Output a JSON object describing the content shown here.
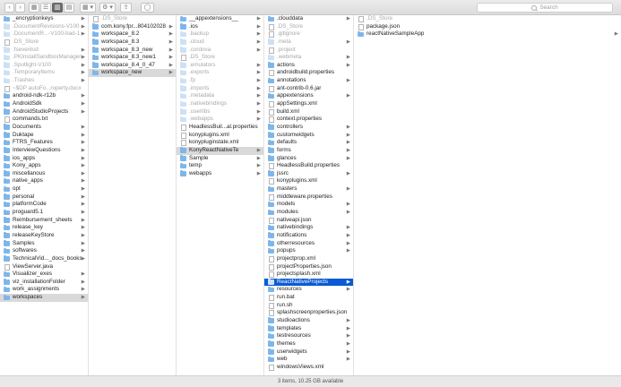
{
  "toolbar": {
    "back": "‹",
    "forward": "›",
    "view_icons": "▦",
    "view_list": "☰",
    "view_columns": "▥",
    "view_gallery": "▤",
    "group": "▦ ▾",
    "action": "⚙ ▾",
    "share": "⇪",
    "tag": "◯",
    "search_placeholder": "Search"
  },
  "columns": [
    [
      {
        "name": "_encryptionkeys",
        "kind": "folder",
        "dim": false,
        "arrow": true
      },
      {
        "name": ".DocumentRevisions-V100",
        "kind": "folder",
        "dim": true,
        "arrow": true
      },
      {
        "name": ".DocumentR...-V100-bad-1",
        "kind": "folder",
        "dim": true,
        "arrow": true
      },
      {
        "name": ".DS_Store",
        "kind": "file",
        "dim": true,
        "arrow": false
      },
      {
        "name": ".fseventsd",
        "kind": "folder",
        "dim": true,
        "arrow": true
      },
      {
        "name": ".PKInstallSandboxManager",
        "kind": "folder",
        "dim": true,
        "arrow": true
      },
      {
        "name": ".Spotlight-V100",
        "kind": "folder",
        "dim": true,
        "arrow": true
      },
      {
        "name": ".TemporaryItems",
        "kind": "folder",
        "dim": true,
        "arrow": true
      },
      {
        "name": ".Trashes",
        "kind": "folder",
        "dim": true,
        "arrow": true
      },
      {
        "name": "~$DP autoFo...roperty.docx",
        "kind": "file",
        "dim": true,
        "arrow": false
      },
      {
        "name": "android-ndk-r12b",
        "kind": "folder",
        "dim": false,
        "arrow": true
      },
      {
        "name": "AndroidSdk",
        "kind": "folder",
        "dim": false,
        "arrow": true
      },
      {
        "name": "AndroidStudioProjects",
        "kind": "folder",
        "dim": false,
        "arrow": true
      },
      {
        "name": "commands.txt",
        "kind": "file",
        "dim": false,
        "arrow": false
      },
      {
        "name": "Documents",
        "kind": "folder",
        "dim": false,
        "arrow": true
      },
      {
        "name": "Duktape",
        "kind": "folder",
        "dim": false,
        "arrow": true
      },
      {
        "name": "FTRS_Features",
        "kind": "folder",
        "dim": false,
        "arrow": true
      },
      {
        "name": "InterviewQuestions",
        "kind": "folder",
        "dim": false,
        "arrow": true
      },
      {
        "name": "ios_apps",
        "kind": "folder",
        "dim": false,
        "arrow": true
      },
      {
        "name": "Kony_apps",
        "kind": "folder",
        "dim": false,
        "arrow": true
      },
      {
        "name": "miscellanous",
        "kind": "folder",
        "dim": false,
        "arrow": true
      },
      {
        "name": "native_apps",
        "kind": "folder",
        "dim": false,
        "arrow": true
      },
      {
        "name": "opt",
        "kind": "folder",
        "dim": false,
        "arrow": true
      },
      {
        "name": "personal",
        "kind": "folder",
        "dim": false,
        "arrow": true
      },
      {
        "name": "platformCode",
        "kind": "folder",
        "dim": false,
        "arrow": true
      },
      {
        "name": "proguard5.1",
        "kind": "folder",
        "dim": false,
        "arrow": true
      },
      {
        "name": "Reimbursement_sheets",
        "kind": "folder",
        "dim": false,
        "arrow": true
      },
      {
        "name": "release_key",
        "kind": "folder",
        "dim": false,
        "arrow": true
      },
      {
        "name": "releaseKeyStore",
        "kind": "folder",
        "dim": false,
        "arrow": true
      },
      {
        "name": "Samples",
        "kind": "folder",
        "dim": false,
        "arrow": true
      },
      {
        "name": "softwares",
        "kind": "folder",
        "dim": false,
        "arrow": true
      },
      {
        "name": "TechnicalVid..._docs_books",
        "kind": "folder",
        "dim": false,
        "arrow": true
      },
      {
        "name": "ViewServer.java",
        "kind": "file",
        "dim": false,
        "arrow": false
      },
      {
        "name": "Visualizer_exes",
        "kind": "folder",
        "dim": false,
        "arrow": true
      },
      {
        "name": "viz_installationFolder",
        "kind": "folder",
        "dim": false,
        "arrow": true
      },
      {
        "name": "work_assignments",
        "kind": "folder",
        "dim": false,
        "arrow": true
      },
      {
        "name": "workspaces",
        "kind": "folder",
        "dim": false,
        "arrow": true,
        "state": "highlight"
      }
    ],
    [
      {
        "name": ".DS_Store",
        "kind": "file",
        "dim": true,
        "arrow": false
      },
      {
        "name": "com.kony.fpr...804102028",
        "kind": "folder",
        "dim": false,
        "arrow": true
      },
      {
        "name": "workspace_8.2",
        "kind": "folder",
        "dim": false,
        "arrow": true
      },
      {
        "name": "workspace_8.3",
        "kind": "folder",
        "dim": false,
        "arrow": true
      },
      {
        "name": "workspace_8.3_new",
        "kind": "folder",
        "dim": false,
        "arrow": true
      },
      {
        "name": "workspace_8.3_new1",
        "kind": "folder",
        "dim": false,
        "arrow": true
      },
      {
        "name": "workspace_8.4_0_47",
        "kind": "folder",
        "dim": false,
        "arrow": true
      },
      {
        "name": "workspace_new",
        "kind": "folder",
        "dim": false,
        "arrow": true,
        "state": "highlight"
      }
    ],
    [
      {
        "name": "__appextensions__",
        "kind": "folder",
        "dim": false,
        "arrow": true
      },
      {
        "name": ".ios",
        "kind": "folder",
        "dim": false,
        "arrow": true
      },
      {
        "name": ".backup",
        "kind": "folder",
        "dim": true,
        "arrow": true
      },
      {
        "name": ".cloud",
        "kind": "folder",
        "dim": true,
        "arrow": true
      },
      {
        "name": ".cordova",
        "kind": "folder",
        "dim": true,
        "arrow": true
      },
      {
        "name": ".DS_Store",
        "kind": "file",
        "dim": true,
        "arrow": false
      },
      {
        "name": ".emulators",
        "kind": "folder",
        "dim": true,
        "arrow": true
      },
      {
        "name": ".exports",
        "kind": "folder",
        "dim": true,
        "arrow": true
      },
      {
        "name": ".fp",
        "kind": "folder",
        "dim": true,
        "arrow": true
      },
      {
        "name": ".imports",
        "kind": "folder",
        "dim": true,
        "arrow": true
      },
      {
        "name": ".metadata",
        "kind": "folder",
        "dim": true,
        "arrow": true
      },
      {
        "name": ".nativebindings",
        "kind": "folder",
        "dim": true,
        "arrow": true
      },
      {
        "name": ".userlibs",
        "kind": "folder",
        "dim": true,
        "arrow": true
      },
      {
        "name": ".webapps",
        "kind": "folder",
        "dim": true,
        "arrow": true
      },
      {
        "name": "HeadlessBuil...al.properties",
        "kind": "file",
        "dim": false,
        "arrow": false
      },
      {
        "name": "konyplugins.xml",
        "kind": "file",
        "dim": false,
        "arrow": false
      },
      {
        "name": "konypluginstate.xml",
        "kind": "file",
        "dim": false,
        "arrow": false
      },
      {
        "name": "KonyReactNativeTe",
        "kind": "folder",
        "dim": false,
        "arrow": true,
        "state": "highlight"
      },
      {
        "name": "Sample",
        "kind": "folder",
        "dim": false,
        "arrow": true
      },
      {
        "name": "temp",
        "kind": "folder",
        "dim": false,
        "arrow": true
      },
      {
        "name": "webapps",
        "kind": "folder",
        "dim": false,
        "arrow": true
      }
    ],
    [
      {
        "name": ".clouddata",
        "kind": "folder",
        "dim": false,
        "arrow": true
      },
      {
        "name": ".DS_Store",
        "kind": "file",
        "dim": true,
        "arrow": false
      },
      {
        "name": ".gitignore",
        "kind": "file",
        "dim": true,
        "arrow": false
      },
      {
        "name": ".meta",
        "kind": "folder",
        "dim": true,
        "arrow": true
      },
      {
        "name": ".project",
        "kind": "file",
        "dim": true,
        "arrow": false
      },
      {
        "name": ".webmeta",
        "kind": "folder",
        "dim": true,
        "arrow": true
      },
      {
        "name": "actions",
        "kind": "folder",
        "dim": false,
        "arrow": true
      },
      {
        "name": "androidbuild.properties",
        "kind": "file",
        "dim": false,
        "arrow": false
      },
      {
        "name": "annotations",
        "kind": "folder",
        "dim": false,
        "arrow": true
      },
      {
        "name": "ant-contrib-0.6.jar",
        "kind": "file",
        "dim": false,
        "arrow": false
      },
      {
        "name": "appextensions",
        "kind": "folder",
        "dim": false,
        "arrow": true
      },
      {
        "name": "appSettings.xml",
        "kind": "file",
        "dim": false,
        "arrow": false
      },
      {
        "name": "build.xml",
        "kind": "file",
        "dim": false,
        "arrow": false
      },
      {
        "name": "context.properties",
        "kind": "file",
        "dim": false,
        "arrow": false
      },
      {
        "name": "controllers",
        "kind": "folder",
        "dim": false,
        "arrow": true
      },
      {
        "name": "customwidgets",
        "kind": "folder",
        "dim": false,
        "arrow": true
      },
      {
        "name": "defaults",
        "kind": "folder",
        "dim": false,
        "arrow": true
      },
      {
        "name": "forms",
        "kind": "folder",
        "dim": false,
        "arrow": true
      },
      {
        "name": "glances",
        "kind": "folder",
        "dim": false,
        "arrow": true
      },
      {
        "name": "HeadlessBuild.properties",
        "kind": "file",
        "dim": false,
        "arrow": false
      },
      {
        "name": "jssrc",
        "kind": "folder",
        "dim": false,
        "arrow": true
      },
      {
        "name": "konyplugins.xml",
        "kind": "file",
        "dim": false,
        "arrow": false
      },
      {
        "name": "masters",
        "kind": "folder",
        "dim": false,
        "arrow": true
      },
      {
        "name": "middleware.properties",
        "kind": "file",
        "dim": false,
        "arrow": false
      },
      {
        "name": "models",
        "kind": "folder",
        "dim": false,
        "arrow": true
      },
      {
        "name": "modules",
        "kind": "folder",
        "dim": false,
        "arrow": true
      },
      {
        "name": "nativeapi.json",
        "kind": "file",
        "dim": false,
        "arrow": false
      },
      {
        "name": "nativebindings",
        "kind": "folder",
        "dim": false,
        "arrow": true
      },
      {
        "name": "notifications",
        "kind": "folder",
        "dim": false,
        "arrow": true
      },
      {
        "name": "otherresources",
        "kind": "folder",
        "dim": false,
        "arrow": true
      },
      {
        "name": "popups",
        "kind": "folder",
        "dim": false,
        "arrow": true
      },
      {
        "name": "projectprop.xml",
        "kind": "file",
        "dim": false,
        "arrow": false
      },
      {
        "name": "projectProperties.json",
        "kind": "file",
        "dim": false,
        "arrow": false
      },
      {
        "name": "projectsplash.xml",
        "kind": "file",
        "dim": false,
        "arrow": false
      },
      {
        "name": "ReactNativeProjects",
        "kind": "folder",
        "dim": false,
        "arrow": true,
        "state": "selected"
      },
      {
        "name": "resources",
        "kind": "folder",
        "dim": false,
        "arrow": true
      },
      {
        "name": "run.bat",
        "kind": "file",
        "dim": false,
        "arrow": false
      },
      {
        "name": "run.sh",
        "kind": "file",
        "dim": false,
        "arrow": false
      },
      {
        "name": "splashscreenproperties.json",
        "kind": "file",
        "dim": false,
        "arrow": false
      },
      {
        "name": "studioactions",
        "kind": "folder",
        "dim": false,
        "arrow": true
      },
      {
        "name": "templates",
        "kind": "folder",
        "dim": false,
        "arrow": true
      },
      {
        "name": "testresources",
        "kind": "folder",
        "dim": false,
        "arrow": true
      },
      {
        "name": "themes",
        "kind": "folder",
        "dim": false,
        "arrow": true
      },
      {
        "name": "userwidgets",
        "kind": "folder",
        "dim": false,
        "arrow": true
      },
      {
        "name": "web",
        "kind": "folder",
        "dim": false,
        "arrow": true
      },
      {
        "name": "windowsViews.xml",
        "kind": "file",
        "dim": false,
        "arrow": false
      }
    ],
    [
      {
        "name": ".DS_Store",
        "kind": "file",
        "dim": true,
        "arrow": false
      },
      {
        "name": "package.json",
        "kind": "file",
        "dim": false,
        "arrow": false
      },
      {
        "name": "reactNativeSampleApp",
        "kind": "folder",
        "dim": false,
        "arrow": true
      }
    ]
  ],
  "status_bar": {
    "text": "3 items, 10.25 GB available"
  },
  "colors": {
    "selection": "#0a5bd3",
    "folder": "#7fb6ea",
    "inactive_highlight": "#d9d9d9"
  }
}
